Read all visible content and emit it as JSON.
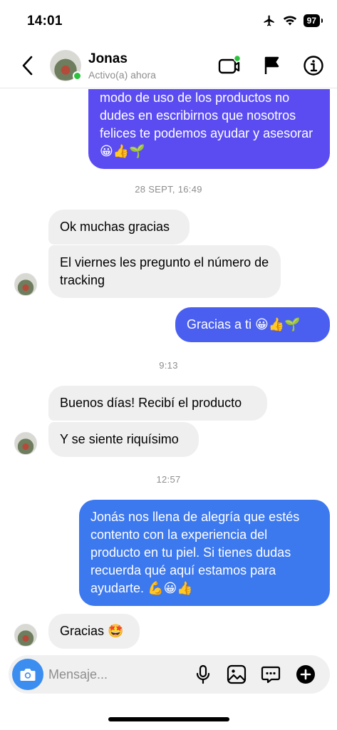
{
  "status_bar": {
    "time": "14:01",
    "battery": "97"
  },
  "header": {
    "name": "Jonas",
    "status": "Activo(a) ahora"
  },
  "messages": [
    {
      "id": "m1",
      "text": "modo de uso de los productos no dudes en escribirnos que nosotros felices te podemos ayudar y asesorar 😀👍🌱"
    },
    {
      "id": "t1",
      "text": "28 SEPT, 16:49"
    },
    {
      "id": "m2",
      "text": "Ok muchas gracias"
    },
    {
      "id": "m3",
      "text": "El viernes les pregunto el número de tracking"
    },
    {
      "id": "m4",
      "text": "Gracias a ti 😀👍🌱"
    },
    {
      "id": "t2",
      "text": "9:13"
    },
    {
      "id": "m5",
      "text": "Buenos días! Recibí el producto"
    },
    {
      "id": "m6",
      "text": "Y se siente riquísimo"
    },
    {
      "id": "t3",
      "text": "12:57"
    },
    {
      "id": "m7",
      "text": "Jonás nos llena de alegría que estés contento con la experiencia del producto en tu piel. Si tienes dudas recuerda qué aquí estamos para ayudarte. 💪😀👍"
    },
    {
      "id": "m8",
      "text": "Gracias 🤩"
    }
  ],
  "composer": {
    "placeholder": "Mensaje..."
  },
  "colors": {
    "outgoing_purple": "#5b4cf2",
    "outgoing_indigo": "#4a5ff0",
    "outgoing_blue": "#3c78ee",
    "incoming": "#efefef",
    "online": "#2bc33d",
    "camera": "#3b8df0"
  }
}
